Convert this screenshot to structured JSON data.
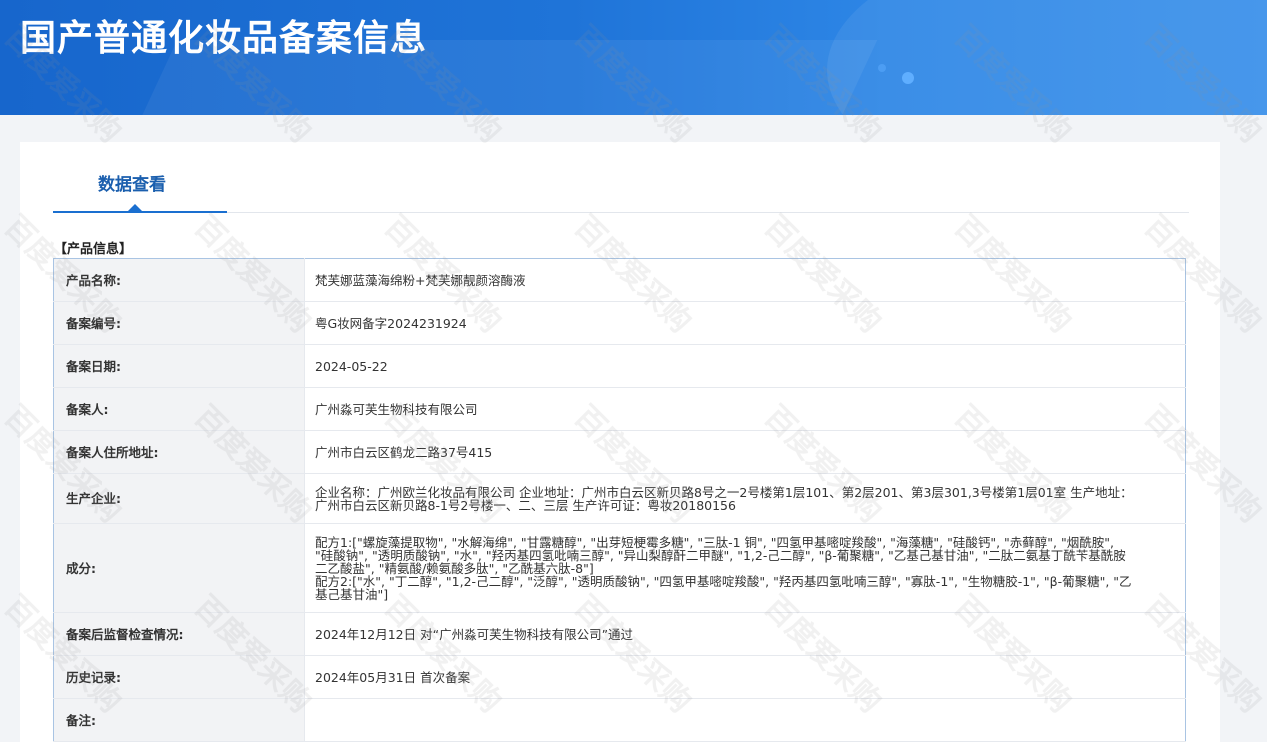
{
  "header": {
    "title": "国产普通化妆品备案信息"
  },
  "tabs": [
    {
      "label": "数据查看"
    }
  ],
  "section": {
    "title": "【产品信息】"
  },
  "rows": [
    {
      "label": "产品名称:",
      "value": "梵芙娜蓝藻海绵粉+梵芙娜靓颜溶酶液"
    },
    {
      "label": "备案编号:",
      "value": "粤G妆网备字2024231924"
    },
    {
      "label": "备案日期:",
      "value": "2024-05-22"
    },
    {
      "label": "备案人:",
      "value": "广州淼可芙生物科技有限公司"
    },
    {
      "label": "备案人住所地址:",
      "value": "广州市白云区鹤龙二路37号415"
    },
    {
      "label": "生产企业:",
      "value": "企业名称：广州欧兰化妆品有限公司 企业地址：广州市白云区新贝路8号之一2号楼第1层101、第2层201、第3层301,3号楼第1层01室 生产地址：广州市白云区新贝路8-1号2号楼一、二、三层 生产许可证：粤妆20180156"
    },
    {
      "label": "成分:",
      "value_lines": [
        "配方1:[\"螺旋藻提取物\", \"水解海绵\", \"甘露糖醇\", \"出芽短梗霉多糖\", \"三肽-1 铜\", \"四氢甲基嘧啶羧酸\", \"海藻糖\", \"硅酸钙\", \"赤藓醇\", \"烟酰胺\", \"硅酸钠\", \"透明质酸钠\", \"水\", \"羟丙基四氢吡喃三醇\", \"异山梨醇酐二甲醚\", \"1,2-己二醇\", \"β-葡聚糖\", \"乙基己基甘油\", \"二肽二氨基丁酰苄基酰胺二乙酸盐\", \"精氨酸/赖氨酸多肽\", \"乙酰基六肽-8\"]",
        "配方2:[\"水\", \"丁二醇\", \"1,2-己二醇\", \"泛醇\", \"透明质酸钠\", \"四氢甲基嘧啶羧酸\", \"羟丙基四氢吡喃三醇\", \"寡肽-1\", \"生物糖胶-1\", \"β-葡聚糖\", \"乙基己基甘油\"]"
      ]
    },
    {
      "label": "备案后监督检查情况:",
      "value": "2024年12月12日 对“广州淼可芙生物科技有限公司”通过"
    },
    {
      "label": "历史记录:",
      "value": "2024年05月31日 首次备案"
    },
    {
      "label": "备注:",
      "value": ""
    }
  ],
  "watermark": {
    "text": "百度爱采购"
  },
  "colors": {
    "banner": "#1f74d8",
    "accent": "#1a6fd0",
    "label_bg": "#f2f3f5"
  }
}
